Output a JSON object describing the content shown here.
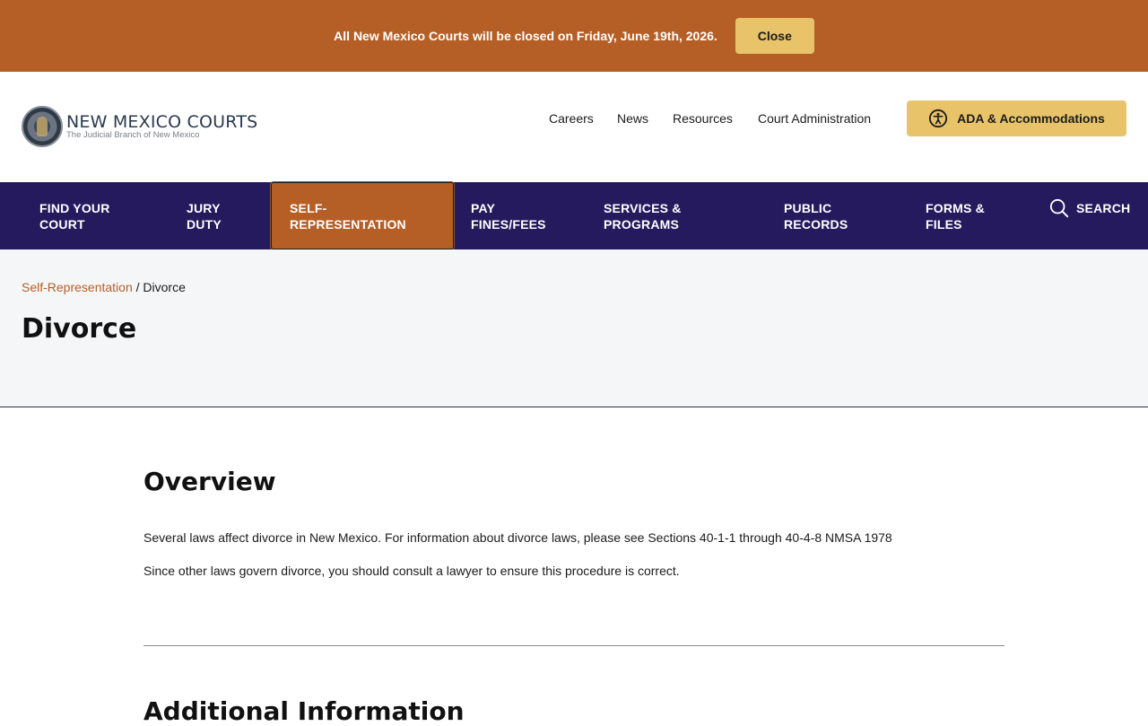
{
  "alert": {
    "text": "All New Mexico Courts will be closed on Friday, June 19th, 2026.",
    "close_label": "Close"
  },
  "logo": {
    "title": "NEW MEXICO COURTS",
    "subtitle": "The Judicial Branch of New Mexico"
  },
  "util_nav": [
    {
      "label": "Careers"
    },
    {
      "label": "News"
    },
    {
      "label": "Resources"
    },
    {
      "label": "Court Administration"
    }
  ],
  "ada_button": {
    "label": "ADA & Accommodations",
    "icon": "accessibility-icon"
  },
  "main_nav": [
    {
      "label": "FIND YOUR\nCOURT"
    },
    {
      "label": "JURY\nDUTY"
    },
    {
      "label": "SELF-\nREPRESENTATION",
      "active": true
    },
    {
      "label": "PAY\nFINES/FEES"
    },
    {
      "label": "SERVICES &\nPROGRAMS"
    },
    {
      "label": "PUBLIC\nRECORDS"
    },
    {
      "label": "FORMS &\nFILES"
    }
  ],
  "search": {
    "label": "SEARCH",
    "icon": "search-icon"
  },
  "breadcrumb": {
    "parent": "Self-Representation",
    "separator": " / ",
    "current": "Divorce"
  },
  "page_title": "Divorce",
  "overview": {
    "heading": "Overview",
    "paragraphs": [
      "Several laws affect divorce in New Mexico. For information about divorce laws, please see Sections 40-1-1 through 40-4-8 NMSA 1978",
      "Since other laws govern divorce, you should consult a lawyer to ensure this procedure is correct."
    ]
  },
  "additional": {
    "heading": "Additional Information"
  },
  "colors": {
    "banner": "#b55f26",
    "button_gold": "#e8c36a",
    "nav_purple": "#261a5e",
    "title_band": "#f5f6f8"
  }
}
